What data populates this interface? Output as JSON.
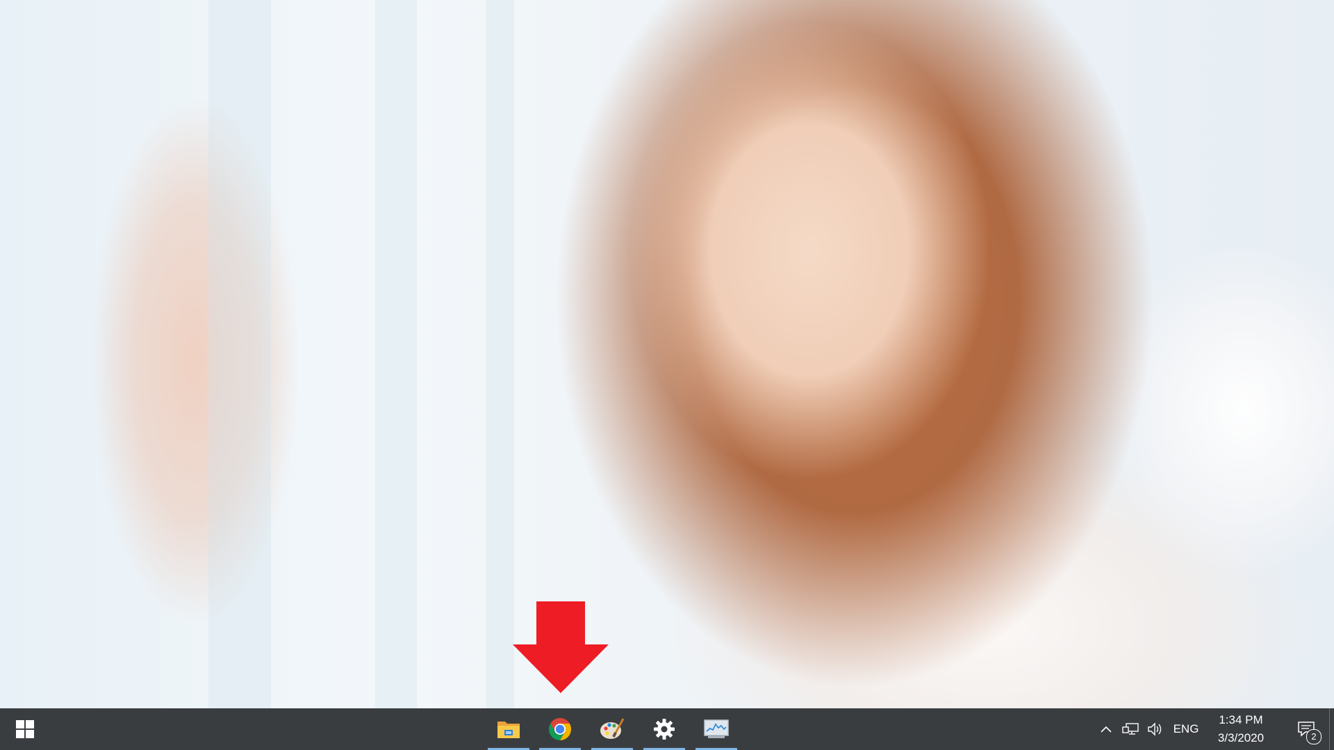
{
  "desktop": {
    "wallpaper": "photo-wallpaper",
    "highlight_arrow": {
      "color": "#ee1c24",
      "icon": "down-arrow-icon"
    }
  },
  "taskbar": {
    "background": "#3a3d40",
    "start_icon": "windows-logo-icon",
    "pinned": [
      {
        "icon": "file-explorer-icon",
        "app": "File Explorer",
        "running": true
      },
      {
        "icon": "chrome-icon",
        "app": "Google Chrome",
        "running": true
      },
      {
        "icon": "paint-icon",
        "app": "Paint",
        "running": true
      },
      {
        "icon": "settings-gear-icon",
        "app": "Settings",
        "running": true
      },
      {
        "icon": "task-manager-icon",
        "app": "Task Manager",
        "running": true
      }
    ],
    "tray": {
      "chevron_icon": "chevron-up-icon",
      "network_icon": "network-icon",
      "volume_icon": "volume-icon",
      "language": "ENG",
      "time": "1:34 PM",
      "date": "3/3/2020",
      "notifications_icon": "action-center-icon",
      "notification_count": "2"
    }
  }
}
